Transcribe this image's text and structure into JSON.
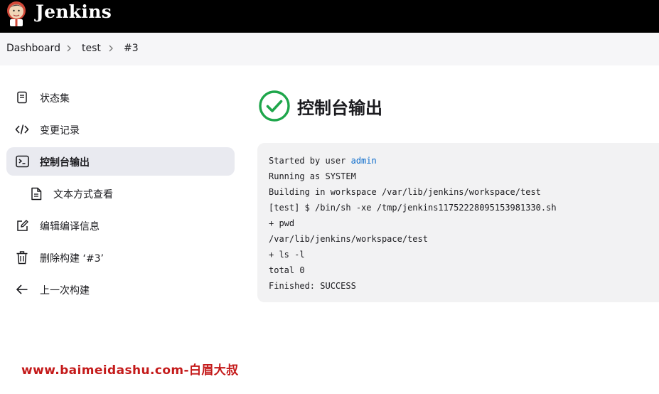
{
  "header": {
    "brand": "Jenkins"
  },
  "breadcrumb": {
    "items": [
      "Dashboard",
      "test",
      "#3"
    ]
  },
  "sidebar": {
    "items": [
      {
        "label": "状态集",
        "icon": "document-icon"
      },
      {
        "label": "变更记录",
        "icon": "code-icon"
      },
      {
        "label": "控制台输出",
        "icon": "terminal-icon",
        "active": true
      },
      {
        "label": "文本方式查看",
        "icon": "file-text-icon",
        "sub": true
      },
      {
        "label": "编辑编译信息",
        "icon": "edit-icon"
      },
      {
        "label": "删除构建 ‘#3’",
        "icon": "trash-icon"
      },
      {
        "label": "上一次构建",
        "icon": "arrow-left-icon"
      }
    ]
  },
  "main": {
    "title": "控制台输出",
    "status_color": "#1ea64b",
    "console": {
      "line0_prefix": "Started by user ",
      "line0_user": "admin",
      "lines": [
        "Running as SYSTEM",
        "Building in workspace /var/lib/jenkins/workspace/test",
        "[test] $ /bin/sh -xe /tmp/jenkins11752228095153981330.sh",
        "+ pwd",
        "/var/lib/jenkins/workspace/test",
        "+ ls -l",
        "total 0",
        "Finished: SUCCESS"
      ]
    }
  },
  "watermark": "www.baimeidashu.com-白眉大叔"
}
